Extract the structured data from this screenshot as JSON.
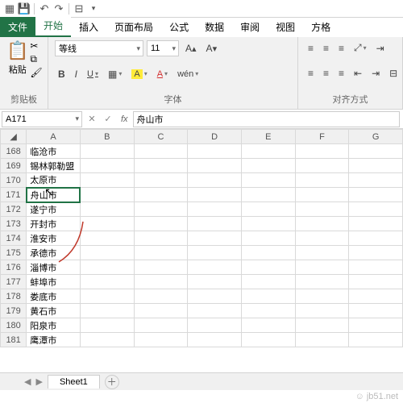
{
  "tabs": {
    "file": "文件",
    "home": "开始",
    "insert": "插入",
    "layout": "页面布局",
    "formulas": "公式",
    "data": "数据",
    "review": "审阅",
    "view": "视图",
    "fangge": "方格"
  },
  "ribbon": {
    "clipboard": {
      "label": "剪贴板",
      "paste": "粘贴"
    },
    "font": {
      "label": "字体",
      "name": "等线",
      "size": "11",
      "bold": "B",
      "italic": "I",
      "underline": "U"
    },
    "align": {
      "label": "对齐方式"
    }
  },
  "namebox": "A171",
  "formula": "舟山市",
  "columns": [
    "A",
    "B",
    "C",
    "D",
    "E",
    "F",
    "G"
  ],
  "rows": [
    {
      "n": "168",
      "a": "临沧市"
    },
    {
      "n": "169",
      "a": "锡林郭勒盟"
    },
    {
      "n": "170",
      "a": "太原市"
    },
    {
      "n": "171",
      "a": "舟山市"
    },
    {
      "n": "172",
      "a": "遂宁市"
    },
    {
      "n": "173",
      "a": "开封市"
    },
    {
      "n": "174",
      "a": "淮安市"
    },
    {
      "n": "175",
      "a": "承德市"
    },
    {
      "n": "176",
      "a": "淄博市"
    },
    {
      "n": "177",
      "a": "蚌埠市"
    },
    {
      "n": "178",
      "a": "娄底市"
    },
    {
      "n": "179",
      "a": "黄石市"
    },
    {
      "n": "180",
      "a": "阳泉市"
    },
    {
      "n": "181",
      "a": "鹰潭市"
    }
  ],
  "sheetname": "Sheet1",
  "watermark": "☺ jb51.net"
}
